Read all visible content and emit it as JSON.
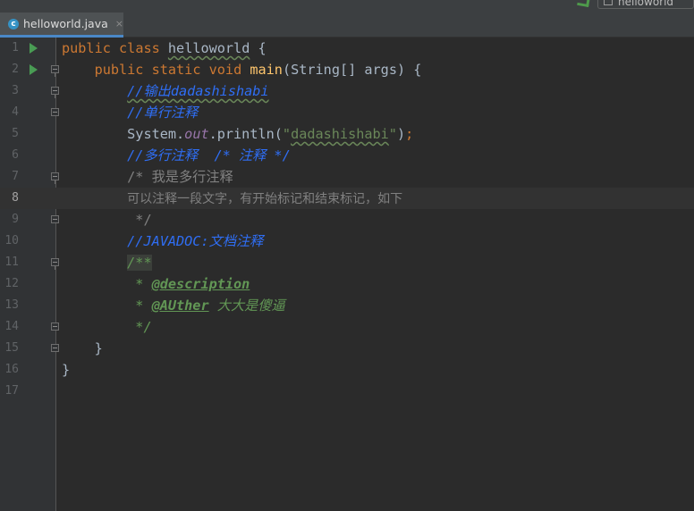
{
  "toolbar": {
    "run_config_label": "helloworld"
  },
  "tab": {
    "icon_letter": "c",
    "title": "helloworld.java",
    "close_glyph": "×"
  },
  "editor": {
    "current_line": 8,
    "lines": [
      {
        "n": "1"
      },
      {
        "n": "2"
      },
      {
        "n": "3"
      },
      {
        "n": "4"
      },
      {
        "n": "5"
      },
      {
        "n": "6"
      },
      {
        "n": "7"
      },
      {
        "n": "8"
      },
      {
        "n": "9"
      },
      {
        "n": "10"
      },
      {
        "n": "11"
      },
      {
        "n": "12"
      },
      {
        "n": "13"
      },
      {
        "n": "14"
      },
      {
        "n": "15"
      },
      {
        "n": "16"
      },
      {
        "n": "17"
      }
    ],
    "code": {
      "l1": {
        "kw1": "public",
        "kw2": "class",
        "name": "helloworld",
        "brace": " {"
      },
      "l2": {
        "kw1": "public",
        "kw2": "static",
        "kw3": "void",
        "fn": "main",
        "rest": "(String[] args) {"
      },
      "l3": {
        "comment": "//输出dadashishabi"
      },
      "l4": {
        "comment": "//单行注释"
      },
      "l5": {
        "pre": "System.",
        "field": "out",
        "mid": ".println(",
        "q1": "\"",
        "str": "dadashishabi",
        "q2": "\"",
        "paren": ")",
        "semi": ";"
      },
      "l6": {
        "comment": "//多行注释  /* 注释 */"
      },
      "l7": {
        "text": "/* 我是多行注释"
      },
      "l8": {
        "text": "可以注释一段文字，有开始标记和结束标记，如下"
      },
      "l9": {
        "text": " */"
      },
      "l10": {
        "comment": "//JAVADOC:文档注释"
      },
      "l11": {
        "text": "/**"
      },
      "l12": {
        "star": " * ",
        "tag": "@description"
      },
      "l13": {
        "star": " * ",
        "tag": "@AUther",
        "desc": " 大大是傻逼"
      },
      "l14": {
        "text": " */"
      },
      "l15": {
        "text": "}"
      },
      "l16": {
        "text": "}"
      }
    }
  }
}
